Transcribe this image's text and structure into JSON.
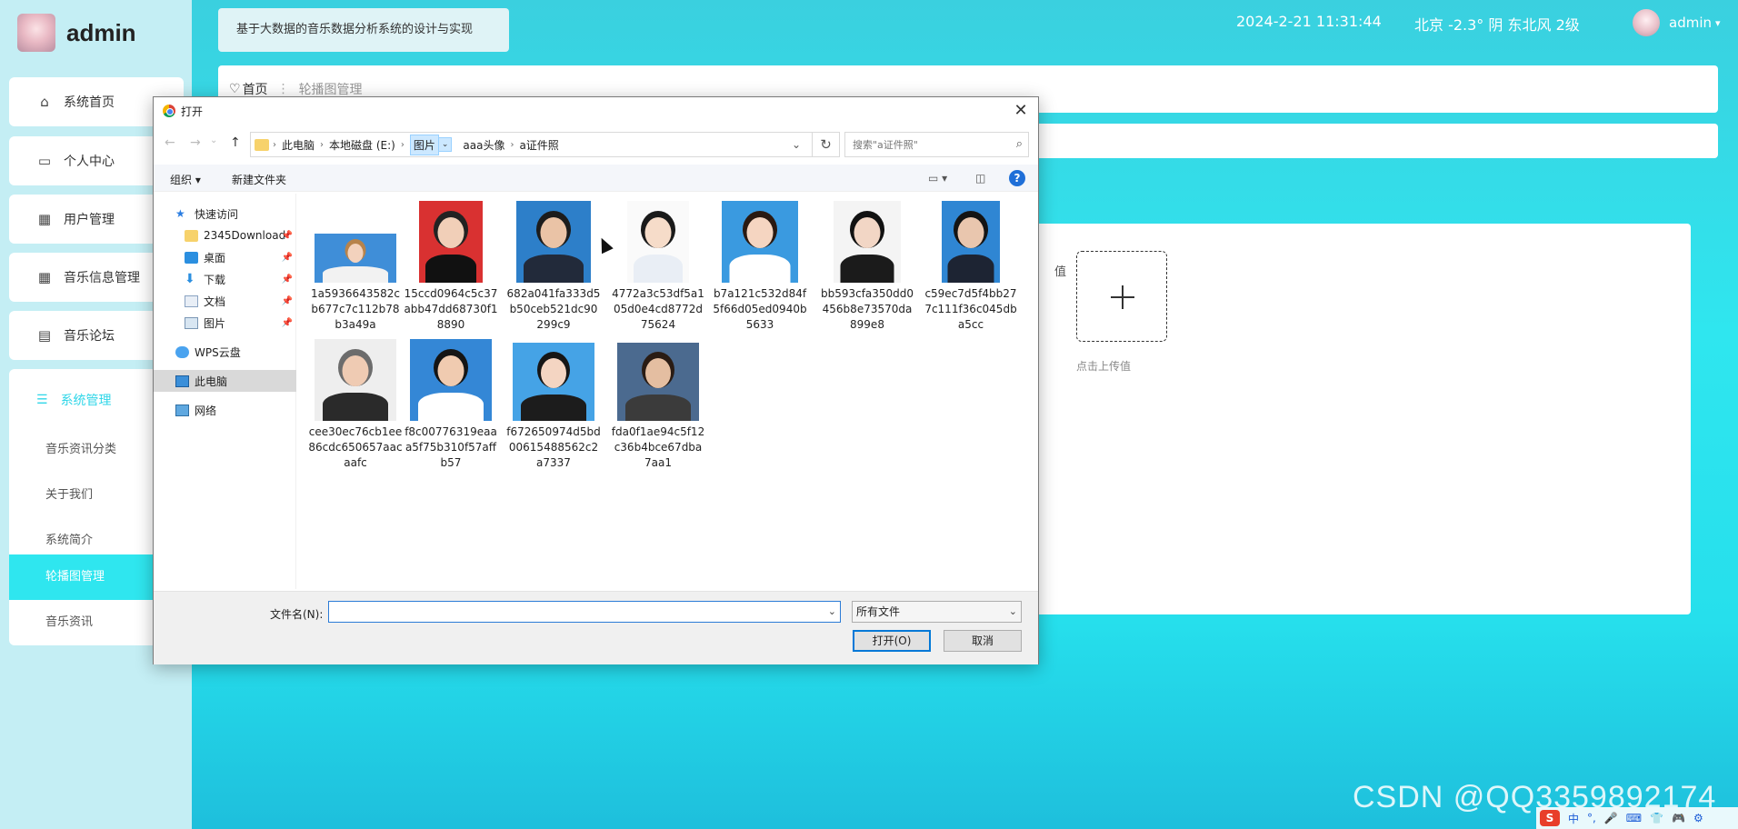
{
  "app": {
    "title": "admin",
    "system_title": "基于大数据的音乐数据分析系统的设计与实现"
  },
  "header": {
    "datetime": "2024-2-21 11:31:44",
    "weather": "北京  -2.3°  阴  东北风  2级",
    "user": "admin",
    "user_caret": "▾"
  },
  "sidebar": {
    "items": [
      {
        "label": "系统首页",
        "icon": "home-icon",
        "glyph": "⌂"
      },
      {
        "label": "个人中心",
        "icon": "card-icon",
        "glyph": "▭"
      },
      {
        "label": "用户管理",
        "icon": "grid-icon",
        "glyph": "▦"
      },
      {
        "label": "音乐信息管理",
        "icon": "grid-icon",
        "glyph": "▦"
      },
      {
        "label": "音乐论坛",
        "icon": "clipboard-icon",
        "glyph": "▤"
      }
    ],
    "system": {
      "label": "系统管理",
      "glyph": "☰",
      "children": [
        {
          "label": "音乐资讯分类"
        },
        {
          "label": "关于我们"
        },
        {
          "label": "系统简介"
        },
        {
          "label": "轮播图管理",
          "active": true
        },
        {
          "label": "音乐资讯"
        }
      ]
    }
  },
  "breadcrumb": {
    "home": "首页",
    "home_glyph": "♡",
    "separator": "⋮",
    "current": "轮播图管理"
  },
  "form": {
    "label": "值",
    "upload_hint": "点击上传值"
  },
  "dialog": {
    "title": "打开",
    "close_glyph": "✕",
    "nav": {
      "back": "←",
      "forward": "→",
      "recent": "⌄",
      "up": "↑",
      "chev": "›",
      "drop": "⌄",
      "refresh": "↻",
      "search_glyph": "⌕"
    },
    "path": [
      "此电脑",
      "本地磁盘 (E:)",
      "图片",
      "aaa头像",
      "a证件照"
    ],
    "search_placeholder": "搜索\"a证件照\"",
    "toolbar": {
      "organize": "组织 ▾",
      "new_folder": "新建文件夹",
      "view": "▭ ▾",
      "pane": "◫",
      "help": "?"
    },
    "nav_pane": [
      {
        "label": "快速访问",
        "icon": "star-icon",
        "pinned": false,
        "glyph": ""
      },
      {
        "label": "2345Download",
        "icon": "folder-icon",
        "pinned": true,
        "glyph": "📌"
      },
      {
        "label": "桌面",
        "icon": "desktop-icon",
        "pinned": true,
        "glyph": "📌"
      },
      {
        "label": "下载",
        "icon": "download-icon",
        "pinned": true,
        "glyph": "📌"
      },
      {
        "label": "文档",
        "icon": "document-icon",
        "pinned": true,
        "glyph": "📌"
      },
      {
        "label": "图片",
        "icon": "pictures-icon",
        "pinned": true,
        "glyph": "📌"
      },
      {
        "label": "WPS云盘",
        "icon": "cloud-icon",
        "pinned": false,
        "glyph": ""
      },
      {
        "label": "此电脑",
        "icon": "computer-icon",
        "pinned": false,
        "selected": true,
        "glyph": ""
      },
      {
        "label": "网络",
        "icon": "network-icon",
        "pinned": false,
        "glyph": ""
      }
    ],
    "files": [
      {
        "name": "1a5936643582cb677c7c112b78b3a49a",
        "bg": "#3f8ed8",
        "skin": "#f3d2bd",
        "hair": "#b7834b",
        "cloth": "#f2f2f2"
      },
      {
        "name": "15ccd0964c5c37abb47dd68730f18890",
        "bg": "#d93131",
        "skin": "#f1cfb8",
        "hair": "#222222",
        "cloth": "#111111"
      },
      {
        "name": "682a041fa333d5b50ceb521dc90299c9",
        "bg": "#2d7fc9",
        "skin": "#eac3a6",
        "hair": "#1c1c1c",
        "cloth": "#222a3a"
      },
      {
        "name": "4772a3c53df5a105d0e4cd8772d75624",
        "bg": "#fafafa",
        "skin": "#f6dcc9",
        "hair": "#1a1a1a",
        "cloth": "#e9eef5"
      },
      {
        "name": "b7a121c532d84f5f66d05ed0940b5633",
        "bg": "#3a9ae0",
        "skin": "#f5d5c1",
        "hair": "#2a1a12",
        "cloth": "#ffffff"
      },
      {
        "name": "bb593cfa350dd0456b8e73570da899e8",
        "bg": "#f4f4f4",
        "skin": "#f2d6c5",
        "hair": "#121212",
        "cloth": "#1b1b1b"
      },
      {
        "name": "c59ec7d5f4bb277c111f36c045dba5cc",
        "bg": "#2f86d3",
        "skin": "#e9c6ae",
        "hair": "#141414",
        "cloth": "#1d2433"
      },
      {
        "name": "cee30ec76cb1ee86cdc650657aacaafc",
        "bg": "#eeeeee",
        "skin": "#efcbb3",
        "hair": "#6c6c6c",
        "cloth": "#2a2a2a"
      },
      {
        "name": "f8c00776319eaaa5f75b310f57affb57",
        "bg": "#3487d6",
        "skin": "#f0cbb0",
        "hair": "#151515",
        "cloth": "#ffffff"
      },
      {
        "name": "f672650974d5bd00615488562c2a7337",
        "bg": "#45a3e6",
        "skin": "#f4d5c2",
        "hair": "#161616",
        "cloth": "#1c1c1c"
      },
      {
        "name": "fda0f1ae94c5f12c36b4bce67dba7aa1",
        "bg": "#4b6a8f",
        "skin": "#e4bea1",
        "hair": "#2a1c14",
        "cloth": "#3b3b3b"
      }
    ],
    "filename_label": "文件名(N):",
    "filename_value": "",
    "filetype": "所有文件",
    "open_button": "打开(O)",
    "cancel_button": "取消",
    "dropdown_glyph": "⌄"
  },
  "watermark": "CSDN @QQ3359892174",
  "tray": {
    "s": "S",
    "items": [
      "中",
      "°,",
      "🎤",
      "⌨",
      "👕",
      "🎮",
      "⚙"
    ]
  },
  "colors": {
    "accent": "#2fe6ef",
    "dialog_primary": "#0078d7"
  }
}
